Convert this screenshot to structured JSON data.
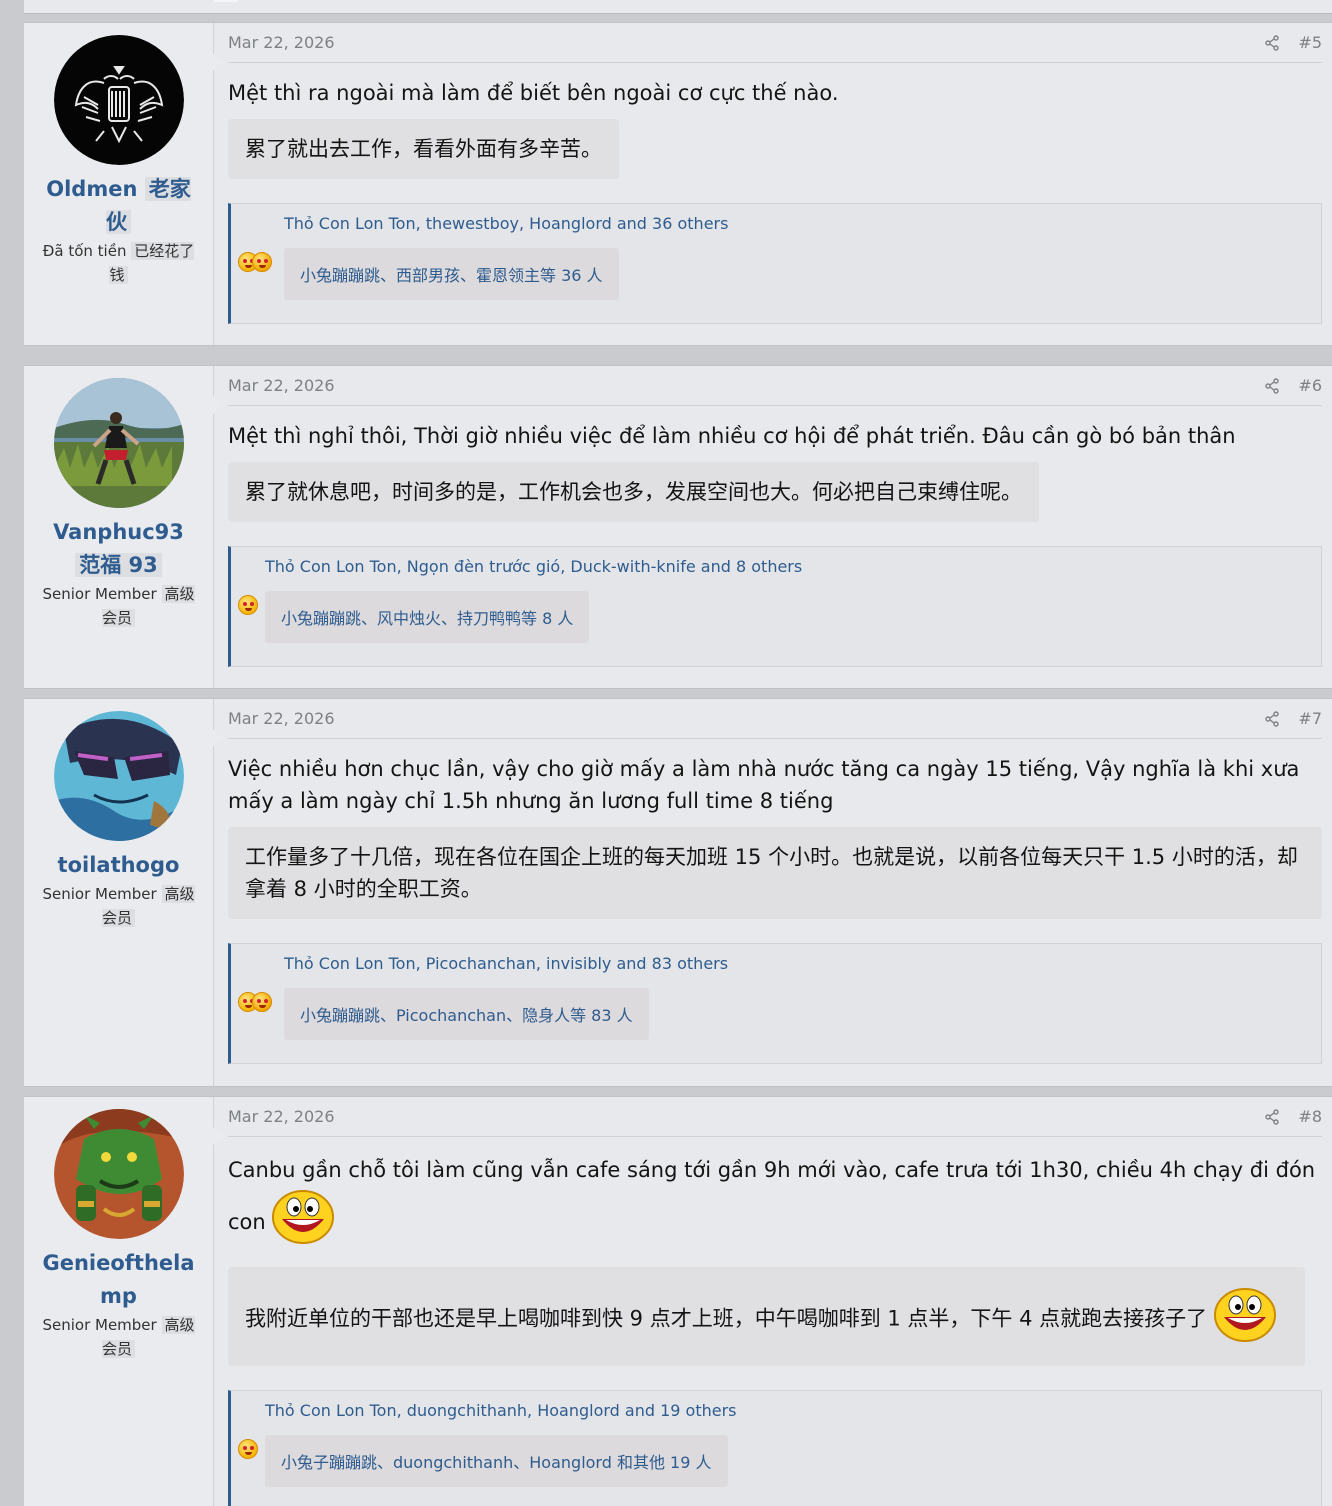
{
  "posts": [
    {
      "date": "Mar 22, 2026",
      "number": "#5",
      "user": {
        "name": "Oldmen",
        "name_trans": "老家伙",
        "title": "Đã tốn tiền",
        "title_trans": "已经花了钱"
      },
      "text": "Mệt thì ra ngoài mà làm để biết bên ngoài cơ cực thế nào.",
      "text_trans": "累了就出去工作，看看外面有多辛苦。",
      "reactions": "Thỏ Con Lon Ton, thewestboy, Hoanglord and 36 others",
      "reactions_trans": "小兔蹦蹦跳、西部男孩、霍恩领主等 36 人"
    },
    {
      "date": "Mar 22, 2026",
      "number": "#6",
      "user": {
        "name": "Vanphuc93",
        "name_trans": "范福 93",
        "title": "Senior Member",
        "title_trans": "高级会员"
      },
      "text": "Mệt thì nghỉ thôi, Thời giờ nhiều việc để làm nhiều cơ hội để phát triển. Đâu cần gò bó bản thân",
      "text_trans": "累了就休息吧，时间多的是，工作机会也多，发展空间也大。何必把自己束缚住呢。",
      "reactions": "Thỏ Con Lon Ton, Ngọn đèn trước gió, Duck-with-knife and 8 others",
      "reactions_trans": "小兔蹦蹦跳、风中烛火、持刀鸭鸭等 8 人"
    },
    {
      "date": "Mar 22, 2026",
      "number": "#7",
      "user": {
        "name": "toilathogo",
        "name_trans": "",
        "title": "Senior Member",
        "title_trans": "高级会员"
      },
      "text": "Việc nhiều hơn chục lần, vậy cho giờ mấy a làm nhà nước tăng ca ngày 15 tiếng, Vậy nghĩa là khi xưa mấy a làm ngày chỉ 1.5h nhưng ăn lương full time 8 tiếng",
      "text_trans": "工作量多了十几倍，现在各位在国企上班的每天加班 15 个小时。也就是说，以前各位每天只干 1.5 小时的活，却拿着 8 小时的全职工资。",
      "reactions": "Thỏ Con Lon Ton, Picochanchan, invisibly and 83 others",
      "reactions_trans": "小兔蹦蹦跳、Picochanchan、隐身人等 83 人"
    },
    {
      "date": "Mar 22, 2026",
      "number": "#8",
      "user": {
        "name": "Genieofthelamp",
        "name_trans": "",
        "title": "Senior Member",
        "title_trans": "高级会员"
      },
      "text": "Canbu gần chỗ tôi làm cũng vẫn cafe sáng tới gần 9h mới vào, cafe trưa tới 1h30, chiều 4h chạy đi đón con",
      "text_trans": "我附近单位的干部也还是早上喝咖啡到快 9 点才上班，中午喝咖啡到 1 点半，下午 4 点就跑去接孩子了",
      "reactions": "Thỏ Con Lon Ton, duongchithanh, Hoanglord and 19 others",
      "reactions_trans": "小兔子蹦蹦跳、duongchithanh、Hoanglord 和其他 19 人"
    }
  ],
  "colors": {
    "accent": "#2f5c8f",
    "background": "#e7e9ec"
  },
  "icons": [
    "share-icon",
    "laugh-reaction-icon",
    "love-reaction-icon",
    "smiley-emoji-icon"
  ]
}
